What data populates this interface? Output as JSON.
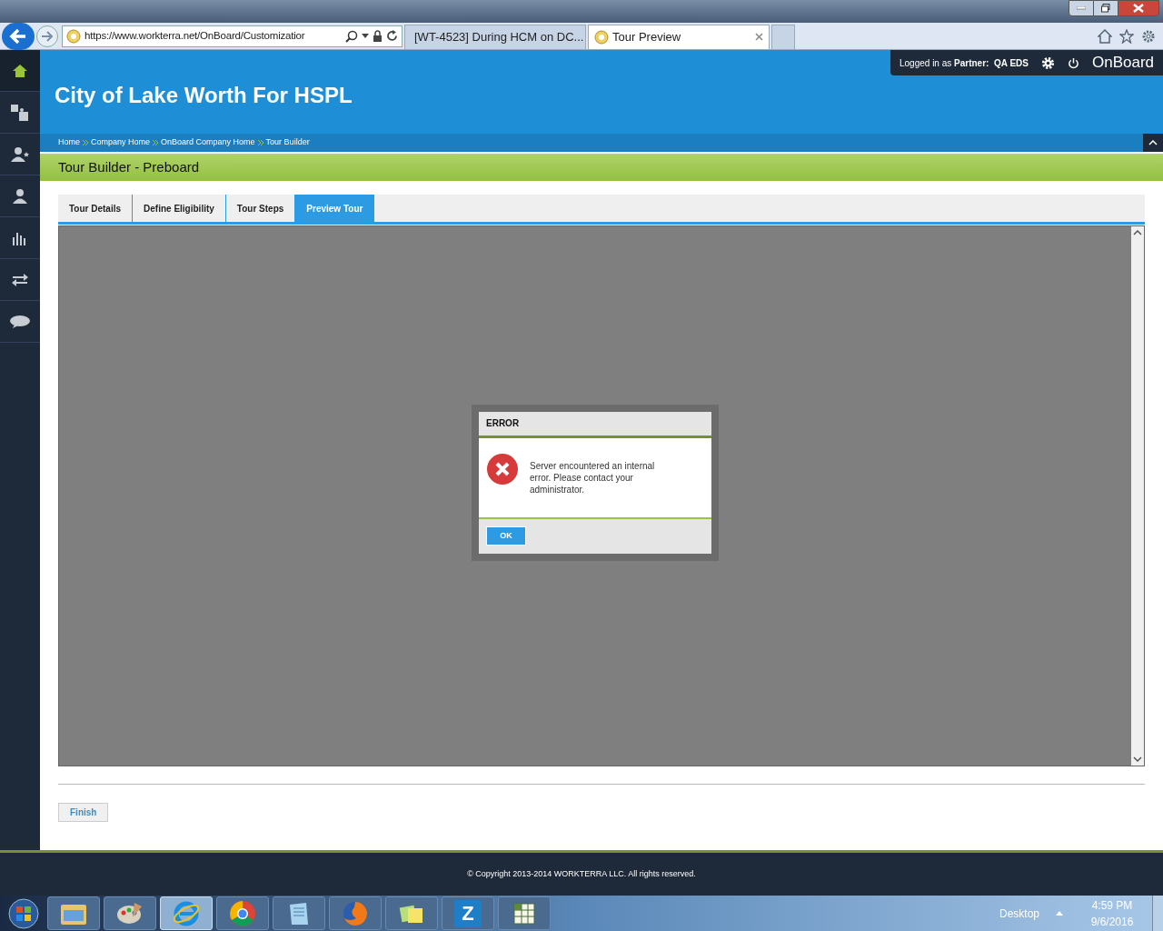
{
  "browser": {
    "address": "https://www.workterra.net/OnBoard/Customizatior",
    "tabs": [
      {
        "title": "[WT-4523] During HCM on DC...",
        "selected": false
      },
      {
        "title": "Tour Preview",
        "selected": true
      }
    ]
  },
  "sidebar": {
    "items": [
      {
        "kind": "home",
        "selected": true
      },
      {
        "kind": "puzzle",
        "selected": false
      },
      {
        "kind": "person-star",
        "selected": false
      },
      {
        "kind": "person",
        "selected": false
      },
      {
        "kind": "chart",
        "selected": false
      },
      {
        "kind": "arrows",
        "selected": false
      },
      {
        "kind": "chat",
        "selected": false
      }
    ]
  },
  "header": {
    "title": "City of Lake Worth For HSPL",
    "user_prefix": "Logged in as",
    "user_role": "Partner:",
    "user_name": "QA EDS",
    "brand": "OnBoard"
  },
  "breadcrumbs": [
    "Home",
    "Company Home",
    "OnBoard Company Home",
    "Tour Builder"
  ],
  "page_title": "Tour Builder - Preboard",
  "tabs": [
    {
      "label": "Tour Details",
      "selected": false
    },
    {
      "label": "Define Eligibility",
      "selected": false
    },
    {
      "label": "Tour Steps",
      "selected": false
    },
    {
      "label": "Preview Tour",
      "selected": true
    }
  ],
  "dialog": {
    "title": "ERROR",
    "message": "Server encountered an internal error. Please contact your administrator.",
    "button": "OK"
  },
  "finish_button": "Finish",
  "footer": "© Copyright 2013-2014 WORKTERRA LLC. All rights reserved.",
  "taskbar": {
    "apps": [
      {
        "kind": "folder"
      },
      {
        "kind": "paint"
      },
      {
        "kind": "ie",
        "selected": true
      },
      {
        "kind": "chrome"
      },
      {
        "kind": "notepad"
      },
      {
        "kind": "firefox"
      },
      {
        "kind": "notes"
      },
      {
        "kind": "letter",
        "label": "Z"
      },
      {
        "kind": "sheet"
      }
    ],
    "desktop": "Desktop",
    "time": "4:59 PM",
    "date": "9/6/2016"
  }
}
